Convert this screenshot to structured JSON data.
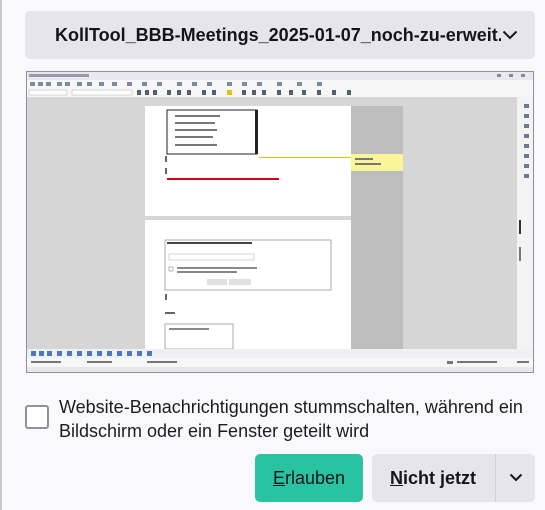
{
  "dialog": {
    "source_select_label": "KollTool_BBB-Meetings_2025-01-07_noch-zu-erweit...",
    "notify_mute_label": "Website-Benachrichtigungen stummschalten, während ein Bildschirm oder ein Fenster geteilt wird",
    "allow_label_access_key": "E",
    "allow_label_rest": "rlauben",
    "not_now_access_key": "N",
    "not_now_rest": "icht jetzt"
  },
  "colors": {
    "allow_button": "#2ac3a2",
    "secondary_button": "#e5e5ea",
    "highlight_comment": "#fbf59a",
    "error_text": "#d0021b"
  },
  "icons": {
    "select_chevron": "chevron-down-icon",
    "not_now_chevron": "chevron-down-icon"
  }
}
